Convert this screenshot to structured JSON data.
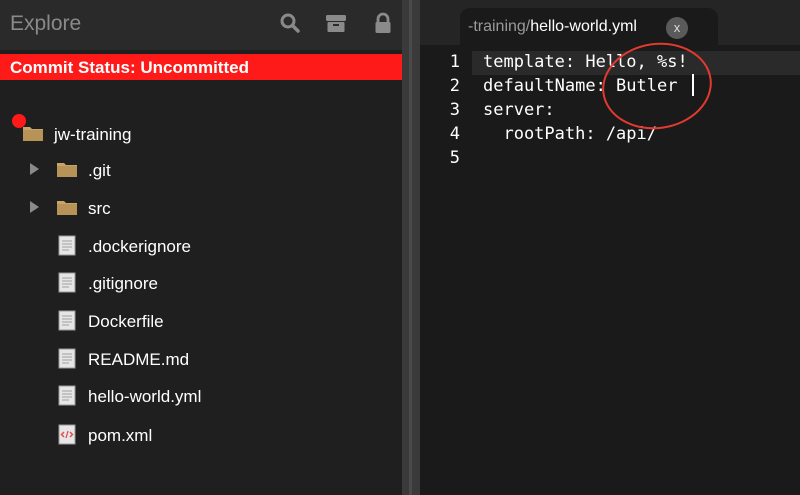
{
  "explorer": {
    "title": "Explore",
    "toolbar_icons": [
      "search-icon",
      "archive-box-icon",
      "lock-icon"
    ],
    "commit_status": "Commit Status: Uncommitted",
    "root": {
      "name": "jw-training",
      "modified": true
    },
    "items": [
      {
        "name": ".git",
        "type": "folder"
      },
      {
        "name": "src",
        "type": "folder"
      },
      {
        "name": ".dockerignore",
        "type": "file"
      },
      {
        "name": ".gitignore",
        "type": "file"
      },
      {
        "name": "Dockerfile",
        "type": "file"
      },
      {
        "name": "README.md",
        "type": "file"
      },
      {
        "name": "hello-world.yml",
        "type": "file"
      },
      {
        "name": "pom.xml",
        "type": "xml-file"
      }
    ]
  },
  "editor": {
    "tab": {
      "prefix": "-training/",
      "name": "hello-world.yml",
      "close_label": "x"
    },
    "lines": [
      {
        "no": "1",
        "text": "template: Hello, %s!"
      },
      {
        "no": "2",
        "text": "defaultName: Butler"
      },
      {
        "no": "3",
        "text": "server:"
      },
      {
        "no": "4",
        "text": "  rootPath: /api/"
      },
      {
        "no": "5",
        "text": ""
      }
    ]
  },
  "colors": {
    "commit_bar": "#ff1a1a",
    "annotation": "#e33a2f",
    "folder": "#c8a46a"
  }
}
